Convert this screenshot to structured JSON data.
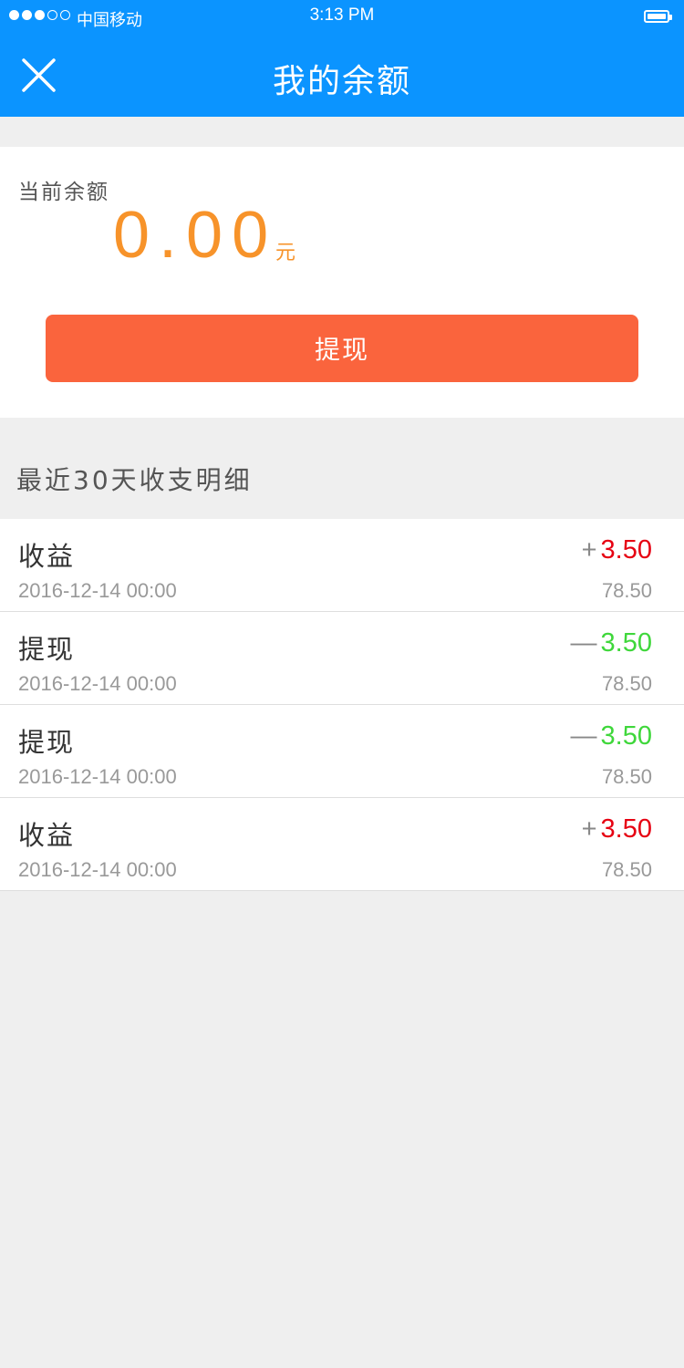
{
  "status_bar": {
    "carrier": "中国移动",
    "time": "3:13 PM"
  },
  "header": {
    "title": "我的余额",
    "close_icon": "close-icon",
    "background_color": "#0b94ff"
  },
  "balance": {
    "label": "当前余额",
    "amount": "0.00",
    "unit": "元",
    "amount_color": "#f7932a",
    "withdraw_button_label": "提现",
    "button_color": "#fa643d"
  },
  "section": {
    "title": "最近30天收支明细"
  },
  "colors": {
    "income": "#e60012",
    "withdrawal": "#3fd73b"
  },
  "transactions": [
    {
      "type": "收益",
      "date": "2016-12-14 00:00",
      "sign": "+",
      "amount": "3.50",
      "kind": "income",
      "balance": "78.50"
    },
    {
      "type": "提现",
      "date": "2016-12-14 00:00",
      "sign": "—",
      "amount": "3.50",
      "kind": "withdrawal",
      "balance": "78.50"
    },
    {
      "type": "提现",
      "date": "2016-12-14 00:00",
      "sign": "—",
      "amount": "3.50",
      "kind": "withdrawal",
      "balance": "78.50"
    },
    {
      "type": "收益",
      "date": "2016-12-14 00:00",
      "sign": "+",
      "amount": "3.50",
      "kind": "income",
      "balance": "78.50"
    }
  ]
}
